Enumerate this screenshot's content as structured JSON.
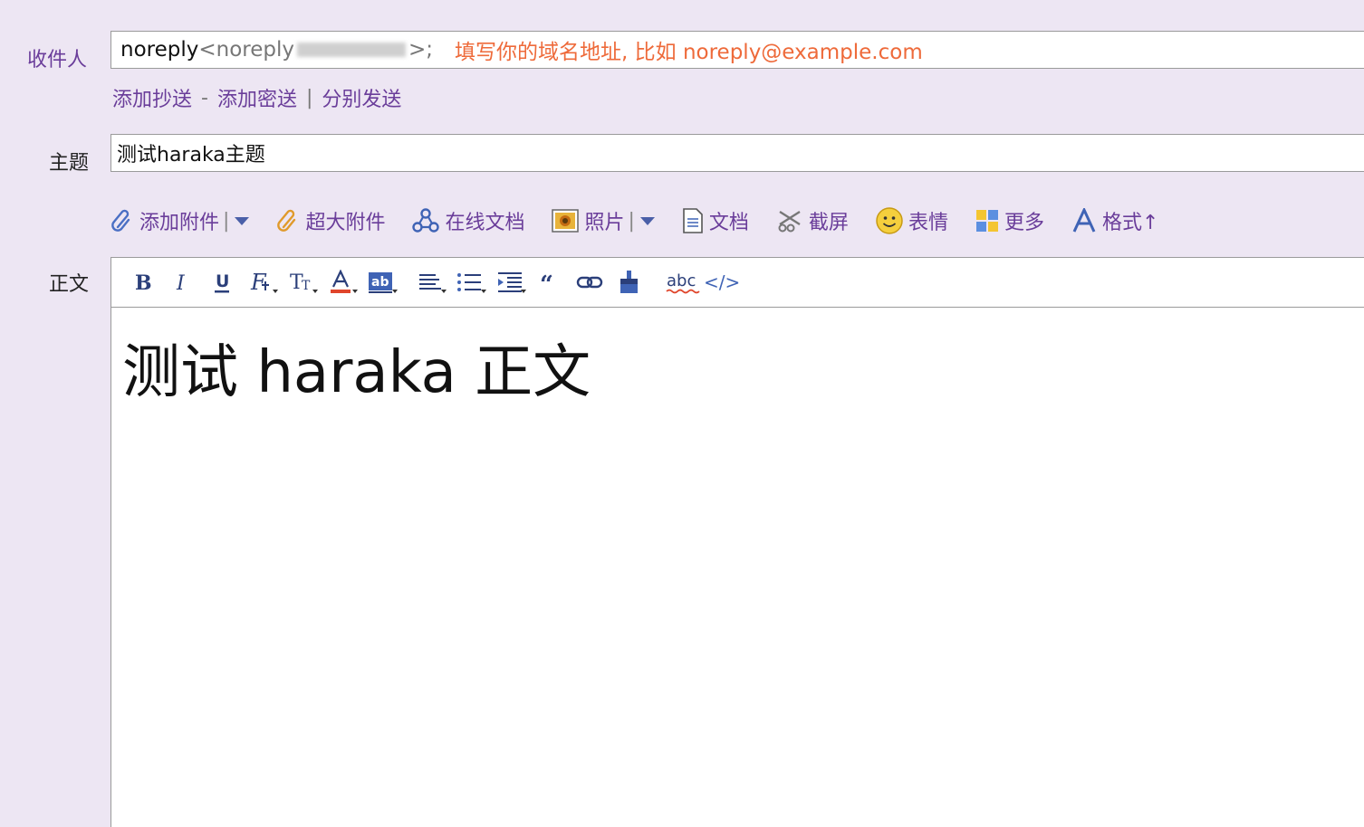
{
  "recipients": {
    "label": "收件人",
    "name": "noreply",
    "address_prefix": "<noreply",
    "address_suffix": ">;",
    "hint": "填写你的域名地址, 比如  noreply@example.com"
  },
  "recipient_links": {
    "add_cc": "添加抄送",
    "sep1": "-",
    "add_bcc": "添加密送",
    "sep2": "|",
    "send_separately": "分别发送"
  },
  "subject": {
    "label": "主题",
    "value": "测试haraka主题"
  },
  "attach_toolbar": {
    "add_attachment": "添加附件",
    "add_attachment_sep": "|",
    "large_attachment": "超大附件",
    "online_doc": "在线文档",
    "photo": "照片",
    "photo_sep": "|",
    "document": "文档",
    "screenshot": "截屏",
    "emoji": "表情",
    "more": "更多",
    "format": "格式↑"
  },
  "body": {
    "label": "正文",
    "content": "测试 haraka 正文"
  },
  "colors": {
    "background": "#ede6f3",
    "link_purple": "#6a3d9a",
    "hint_orange": "#ee6a3a",
    "icon_blue": "#3f63b5"
  },
  "editor_toolbar_icons": [
    "bold-icon",
    "italic-icon",
    "underline-icon",
    "font-family-icon",
    "font-size-icon",
    "font-color-icon",
    "highlight-icon",
    "align-icon",
    "bulleted-list-icon",
    "indent-icon",
    "quote-icon",
    "link-icon",
    "format-painter-icon",
    "spellcheck-icon",
    "source-code-icon"
  ]
}
